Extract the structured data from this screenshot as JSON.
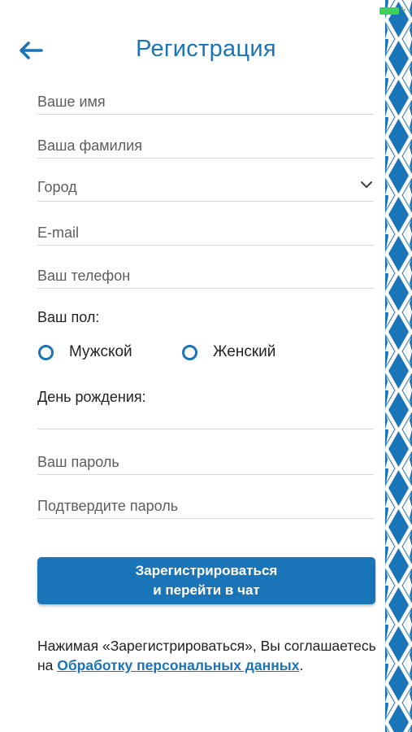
{
  "app": {
    "accent_color": "#1a74b8",
    "pattern_color": "#1a74b8"
  },
  "header": {
    "title": "Регистрация",
    "back_icon": "arrow-left-icon"
  },
  "form": {
    "first_name_placeholder": "Ваше имя",
    "last_name_placeholder": "Ваша фамилия",
    "city_placeholder": "Город",
    "email_placeholder": "E-mail",
    "phone_placeholder": "Ваш телефон",
    "gender_label": "Ваш пол:",
    "gender_options": [
      "Мужской",
      "Женский"
    ],
    "birthday_label": "День рождения:",
    "password_placeholder": "Ваш пароль",
    "confirm_password_placeholder": "Подтвердите пароль"
  },
  "submit": {
    "line1": "Зарегистрироваться",
    "line2": "и перейти в чат"
  },
  "consent": {
    "prefix": "Нажимая «Зарегистрироваться», Вы соглашаетесь на ",
    "link": "Обработку персональных данных",
    "suffix": "."
  }
}
